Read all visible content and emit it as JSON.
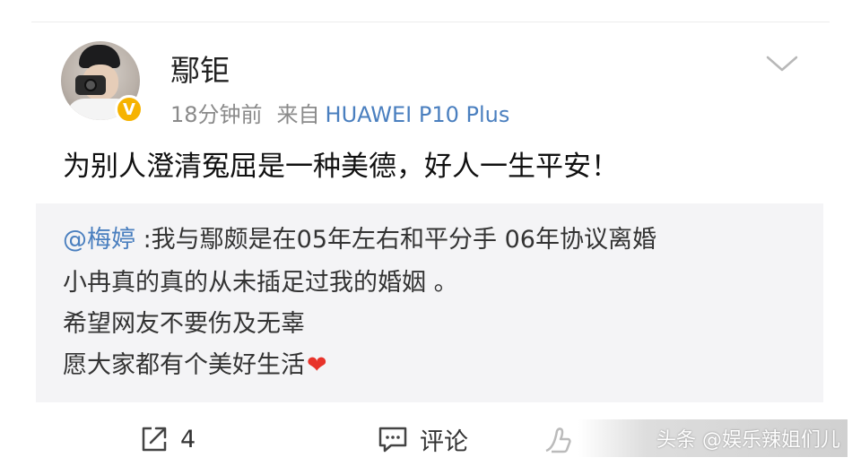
{
  "post": {
    "username": "鄢钜",
    "time": "18分钟前",
    "source_label": "来自",
    "device": "HUAWEI P10 Plus",
    "verified_badge": "V",
    "text": "为别人澄清冤屈是一种美德，好人一生平安！"
  },
  "quote": {
    "mention": "@梅婷",
    "line1_rest": " :我与鄢颇是在05年左右和平分手  06年协议离婚",
    "line2": "小冉真的真的从未插足过我的婚姻 。",
    "line3": "希望网友不要伤及无辜",
    "line4": "愿大家都有个美好生活",
    "line4_emoji": "❤"
  },
  "actions": {
    "repost_count": "4",
    "comment_label": "评论",
    "repost_icon": "share-icon",
    "comment_icon": "comment-icon",
    "like_icon": "like-icon"
  },
  "watermark": {
    "text": "头条 @娱乐辣姐们儿"
  },
  "colors": {
    "link": "#4a7fbf",
    "verified": "#f6b300",
    "heart": "#e8332a",
    "quote_bg": "#f4f4f6"
  }
}
